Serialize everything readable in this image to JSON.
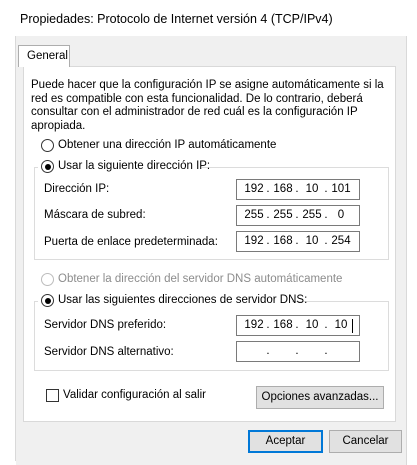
{
  "window": {
    "title": "Propiedades: Protocolo de Internet versión 4 (TCP/IPv4)"
  },
  "tabs": [
    {
      "label": "General"
    }
  ],
  "description": "Puede hacer que la configuración IP se asigne automáticamente si la red es compatible con esta funcionalidad. De lo contrario, deberá consultar con el administrador de red cuál es la configuración IP apropiada.",
  "ip": {
    "auto_label": "Obtener una dirección IP automáticamente",
    "manual_label": "Usar la siguiente dirección IP:",
    "fields": [
      {
        "label": "Dirección IP:",
        "octets": [
          "192",
          "168",
          "10",
          "101"
        ]
      },
      {
        "label": "Máscara de subred:",
        "octets": [
          "255",
          "255",
          "255",
          "0"
        ]
      },
      {
        "label": "Puerta de enlace predeterminada:",
        "octets": [
          "192",
          "168",
          "10",
          "254"
        ]
      }
    ]
  },
  "dns": {
    "auto_label": "Obtener la dirección del servidor DNS automáticamente",
    "manual_label": "Usar las siguientes direcciones de servidor DNS:",
    "fields": [
      {
        "label": "Servidor DNS preferido:",
        "octets": [
          "192",
          "168",
          "10",
          "10"
        ]
      },
      {
        "label": "Servidor DNS alternativo:",
        "octets": [
          "",
          "",
          "",
          ""
        ]
      }
    ]
  },
  "validate_label": "Validar configuración al salir",
  "advanced_label": "Opciones avanzadas...",
  "accept_label": "Aceptar",
  "cancel_label": "Cancelar",
  "separator": "."
}
